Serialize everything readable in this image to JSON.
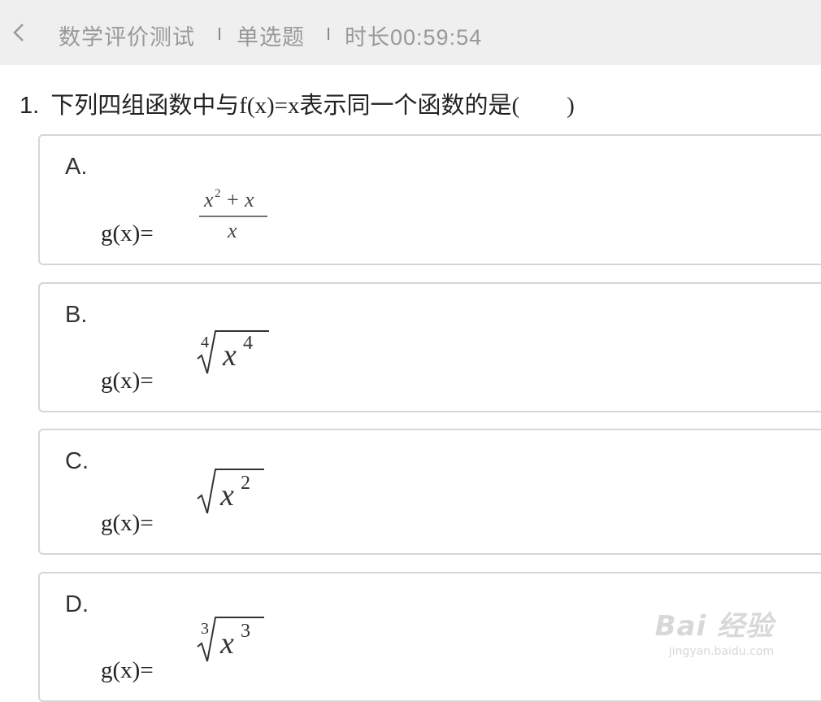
{
  "header": {
    "back_icon": "chevron-left-icon",
    "title": "数学评价测试",
    "type": "单选题",
    "timer": "时长00:59:54"
  },
  "question": {
    "number": "1.",
    "text": "下列四组函数中与f(x)=x表示同一个函数的是(　　)"
  },
  "options": [
    {
      "letter": "A.",
      "prefix": "g(x)=",
      "formula": "(x^2+x)/x"
    },
    {
      "letter": "B.",
      "prefix": "g(x)=",
      "formula": "⁴√(x⁴)"
    },
    {
      "letter": "C.",
      "prefix": "g(x)=",
      "formula": "√(x²)"
    },
    {
      "letter": "D.",
      "prefix": "g(x)=",
      "formula": "³√(x³)"
    }
  ],
  "watermark": {
    "logo": "Bai 经验",
    "url": "jingyan.baidu.com"
  }
}
